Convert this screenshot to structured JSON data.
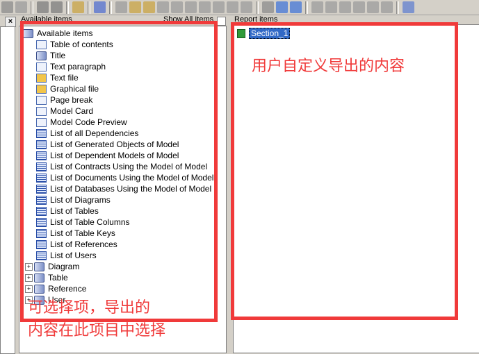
{
  "toolbar": {
    "icons": [
      "cut-icon",
      "delete-icon",
      "undo-icon",
      "redo-icon",
      "properties-icon",
      "help-icon",
      "page-icon",
      "package-icon",
      "diagram-icon",
      "format-icon",
      "page2-icon",
      "shape-icon",
      "text-frame-icon",
      "pen-icon",
      "fill-icon",
      "font-icon",
      "folder-icon",
      "move-left-icon",
      "move-right-icon",
      "align1-icon",
      "align2-icon",
      "align3-icon",
      "align4-icon",
      "align5-icon",
      "align6-icon",
      "preview-icon"
    ]
  },
  "left_panel": {
    "header": "Available items",
    "show_all": "Show All Items",
    "root": "Available items",
    "items": [
      {
        "label": "Table of contents",
        "icon": "doc"
      },
      {
        "label": "Title",
        "icon": "title"
      },
      {
        "label": "Text paragraph",
        "icon": "doc"
      },
      {
        "label": "Text file",
        "icon": "folder"
      },
      {
        "label": "Graphical file",
        "icon": "folder"
      },
      {
        "label": "Page break",
        "icon": "doc"
      },
      {
        "label": "Model Card",
        "icon": "doc"
      },
      {
        "label": "Model Code Preview",
        "icon": "doc"
      },
      {
        "label": "List of all Dependencies",
        "icon": "grid"
      },
      {
        "label": "List of Generated Objects of Model",
        "icon": "grid"
      },
      {
        "label": "List of Dependent Models of Model",
        "icon": "grid"
      },
      {
        "label": "List of Contracts Using the Model of Model",
        "icon": "grid"
      },
      {
        "label": "List of Documents Using the Model of Model",
        "icon": "grid"
      },
      {
        "label": "List of Databases Using the Model of Model",
        "icon": "grid"
      },
      {
        "label": "List of Diagrams",
        "icon": "grid"
      },
      {
        "label": "List of Tables",
        "icon": "grid"
      },
      {
        "label": "List of Table Columns",
        "icon": "grid"
      },
      {
        "label": "List of Table Keys",
        "icon": "grid"
      },
      {
        "label": "List of References",
        "icon": "grid"
      },
      {
        "label": "List of Users",
        "icon": "grid"
      }
    ],
    "groups": [
      "Diagram",
      "Table",
      "Reference",
      "User"
    ]
  },
  "right_panel": {
    "header": "Report items",
    "section": "Section_1"
  },
  "annotations": {
    "right": "用户自定义导出的内容",
    "left_line1": "可选择项，导出的",
    "left_line2": "内容在此项目中选择"
  },
  "colors": {
    "annotation": "#f03a3a",
    "selection": "#3169c6"
  }
}
